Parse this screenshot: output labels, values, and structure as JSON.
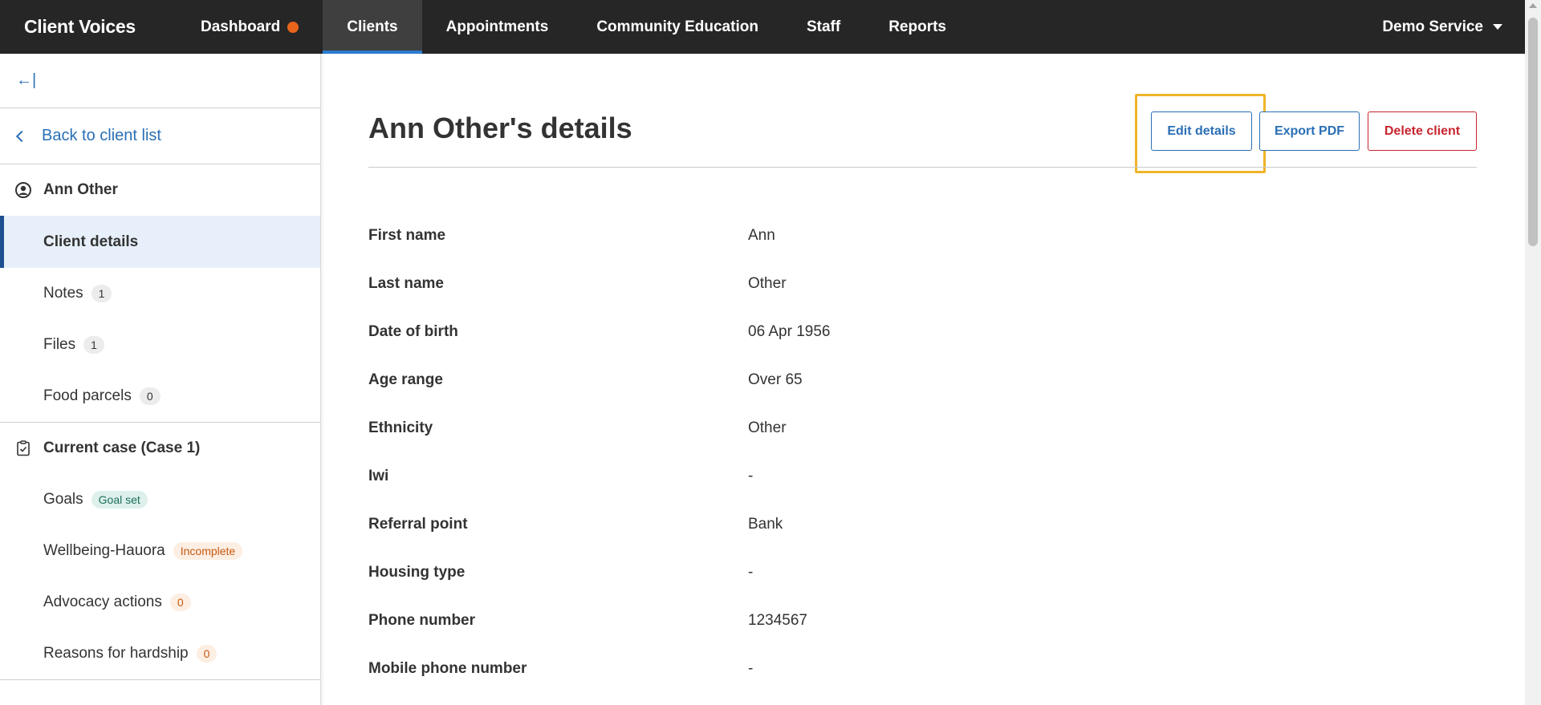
{
  "nav": {
    "brand": "Client Voices",
    "items": [
      {
        "label": "Dashboard",
        "has_dot": true
      },
      {
        "label": "Clients",
        "active": true
      },
      {
        "label": "Appointments"
      },
      {
        "label": "Community Education"
      },
      {
        "label": "Staff"
      },
      {
        "label": "Reports"
      }
    ],
    "account": "Demo Service",
    "accent_color": "#2a7bd0",
    "dot_color": "#e8641b"
  },
  "sidebar": {
    "collapse_icon": "←|",
    "back_label": "Back to client list",
    "client_name": "Ann Other",
    "client_items": [
      {
        "label": "Client details",
        "active": true
      },
      {
        "label": "Notes",
        "badge": "1"
      },
      {
        "label": "Files",
        "badge": "1"
      },
      {
        "label": "Food parcels",
        "badge": "0"
      }
    ],
    "case_title": "Current case (Case 1)",
    "case_items": [
      {
        "label": "Goals",
        "badge": "Goal set",
        "badge_style": "green"
      },
      {
        "label": "Wellbeing-Hauora",
        "badge": "Incomplete",
        "badge_style": "orange"
      },
      {
        "label": "Advocacy actions",
        "badge": "0",
        "badge_style": "orange"
      },
      {
        "label": "Reasons for hardship",
        "badge": "0",
        "badge_style": "orange"
      }
    ]
  },
  "main": {
    "title": "Ann Other's details",
    "buttons": {
      "edit": "Edit details",
      "export": "Export PDF",
      "delete": "Delete client"
    },
    "fields": [
      {
        "label": "First name",
        "value": "Ann"
      },
      {
        "label": "Last name",
        "value": "Other"
      },
      {
        "label": "Date of birth",
        "value": "06 Apr 1956"
      },
      {
        "label": "Age range",
        "value": "Over 65"
      },
      {
        "label": "Ethnicity",
        "value": "Other"
      },
      {
        "label": "Iwi",
        "value": "-"
      },
      {
        "label": "Referral point",
        "value": "Bank"
      },
      {
        "label": "Housing type",
        "value": "-"
      },
      {
        "label": "Phone number",
        "value": "1234567"
      },
      {
        "label": "Mobile phone number",
        "value": "-"
      }
    ]
  }
}
